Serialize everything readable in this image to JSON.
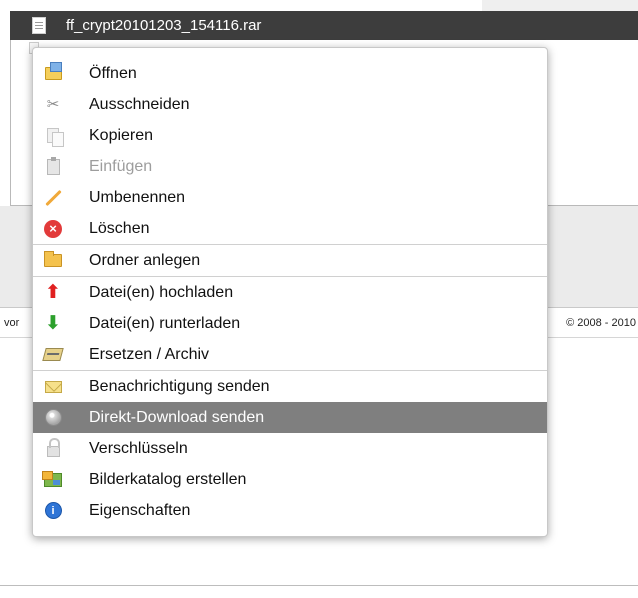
{
  "header": {
    "filename": "ff_crypt20101203_154116.rar",
    "file_icon": "document-icon"
  },
  "footer": {
    "left_text": "vor",
    "right_text": "© 2008 - 2010"
  },
  "menu": {
    "groups": [
      [
        {
          "label": "Öffnen",
          "icon": "open-icon",
          "enabled": true
        },
        {
          "label": "Ausschneiden",
          "icon": "cut-icon",
          "enabled": true
        },
        {
          "label": "Kopieren",
          "icon": "copy-icon",
          "enabled": true
        },
        {
          "label": "Einfügen",
          "icon": "paste-icon",
          "enabled": false
        },
        {
          "label": "Umbenennen",
          "icon": "rename-pencil-icon",
          "enabled": true
        },
        {
          "label": "Löschen",
          "icon": "delete-icon",
          "enabled": true
        }
      ],
      [
        {
          "label": "Ordner anlegen",
          "icon": "folder-icon",
          "enabled": true
        }
      ],
      [
        {
          "label": "Datei(en) hochladen",
          "icon": "upload-arrow-icon",
          "enabled": true
        },
        {
          "label": "Datei(en) runterladen",
          "icon": "download-arrow-icon",
          "enabled": true
        },
        {
          "label": "Ersetzen / Archiv",
          "icon": "archive-icon",
          "enabled": true
        }
      ],
      [
        {
          "label": "Benachrichtigung senden",
          "icon": "mail-icon",
          "enabled": true
        },
        {
          "label": "Direkt-Download senden",
          "icon": "direct-download-icon",
          "enabled": true,
          "highlighted": true
        },
        {
          "label": "Verschlüsseln",
          "icon": "lock-icon",
          "enabled": true
        },
        {
          "label": "Bilderkatalog erstellen",
          "icon": "image-catalog-icon",
          "enabled": true
        },
        {
          "label": "Eigenschaften",
          "icon": "info-icon",
          "enabled": true
        }
      ]
    ]
  },
  "colors": {
    "header_bg": "#3d3d3d",
    "highlight_bg": "#7f7f7f",
    "disabled_text": "#9d9d9d"
  }
}
